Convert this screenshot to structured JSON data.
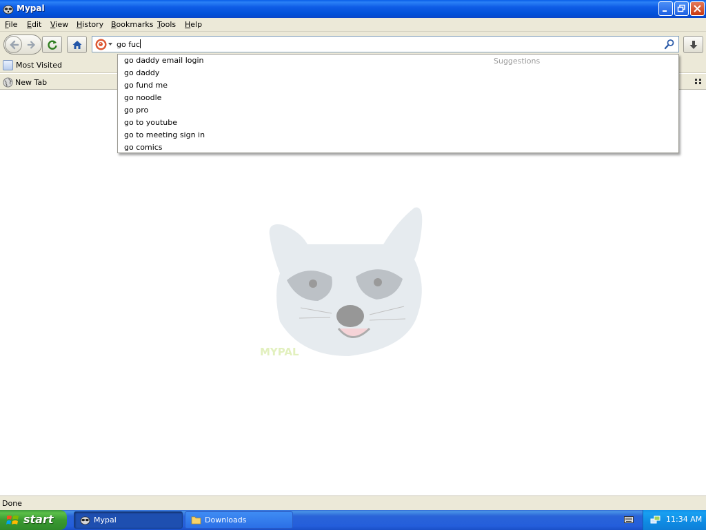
{
  "window": {
    "title": "Mypal",
    "controls": [
      "minimize",
      "restore",
      "close"
    ]
  },
  "menu": {
    "items": [
      {
        "label": "File",
        "accel": "F",
        "rest": "ile"
      },
      {
        "label": "Edit",
        "accel": "E",
        "rest": "dit"
      },
      {
        "label": "View",
        "accel": "V",
        "rest": "iew"
      },
      {
        "label": "History",
        "accel": "H",
        "rest": "istory"
      },
      {
        "label": "Bookmarks",
        "accel": "B",
        "rest": "ookmarks"
      },
      {
        "label": "Tools",
        "accel": "T",
        "rest": "ools"
      },
      {
        "label": "Help",
        "accel": "H",
        "rest": "elp"
      }
    ]
  },
  "toolbar": {
    "url_value": "go fuc",
    "search_engine_icon": "duckduckgo-icon",
    "buttons": [
      "back-icon",
      "forward-icon",
      "reload-icon",
      "home-icon",
      "download-icon"
    ]
  },
  "bookmarks": {
    "items": [
      {
        "label": "Most Visited",
        "icon": "bookmarks-folder-icon"
      }
    ]
  },
  "tabs": [
    {
      "label": "New Tab",
      "icon": "globe-icon",
      "active": true
    }
  ],
  "suggestions": {
    "heading": "Suggestions",
    "items": [
      "go daddy email login",
      "go daddy",
      "go fund me",
      "go noodle",
      "go pro",
      "go to youtube",
      "go to meeting sign in",
      "go comics"
    ]
  },
  "content": {
    "watermark": "raccoon-logo",
    "watermark_text": "MYPAL"
  },
  "status": {
    "text": "Done"
  },
  "taskbar": {
    "start_label": "start",
    "tasks": [
      {
        "label": "Mypal",
        "icon": "mypal-icon",
        "active": true
      },
      {
        "label": "Downloads",
        "icon": "folder-icon",
        "active": false
      }
    ],
    "clock": "11:34 AM"
  },
  "colors": {
    "titlebar": "#0054e3",
    "chrome": "#ece9d8",
    "taskbar": "#245edb",
    "start_button": "#3a9a32",
    "tray": "#0f8be3"
  }
}
